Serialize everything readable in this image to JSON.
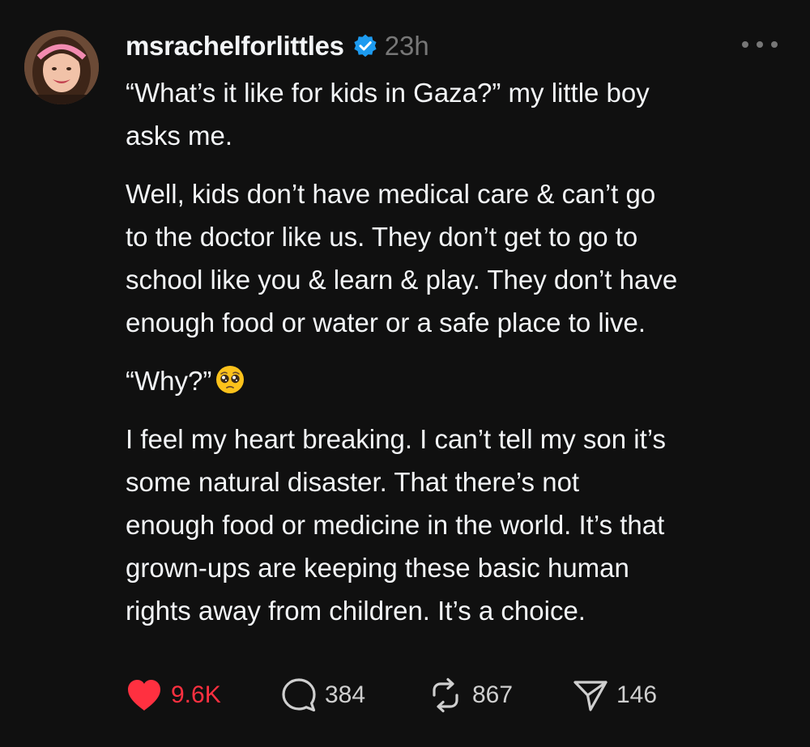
{
  "post": {
    "username": "msrachelforlittles",
    "timestamp": "23h",
    "verified_icon": "verified-badge-icon",
    "colors": {
      "background": "#101010",
      "text": "#f3f5f7",
      "muted": "#777777",
      "like": "#ff3040",
      "verified": "#1d9bf0"
    },
    "paragraphs": [
      {
        "lines": [
          "“What’s it like for kids in Gaza?” my little boy",
          "asks me."
        ]
      },
      {
        "lines": [
          "Well, kids don’t have medical care & can’t go",
          "to the doctor like us. They don’t get to go to",
          "school like you & learn & play. They don’t have",
          "enough food or water or a safe place to live."
        ]
      },
      {
        "lines": [
          "“Why?”"
        ],
        "emoji": "pleading-face-emoji"
      },
      {
        "lines": [
          "I feel my heart breaking. I can’t tell my son it’s",
          "some natural disaster. That there’s not",
          "enough food or medicine in the world. It’s that",
          "grown-ups are keeping these basic human",
          "rights away from children. It’s a choice."
        ]
      }
    ],
    "actions": {
      "like": {
        "icon": "heart-icon",
        "count": "9.6K",
        "liked": true
      },
      "reply": {
        "icon": "speech-bubble-icon",
        "count": "384"
      },
      "repost": {
        "icon": "repost-icon",
        "count": "867"
      },
      "share": {
        "icon": "paper-plane-icon",
        "count": "146"
      }
    }
  }
}
